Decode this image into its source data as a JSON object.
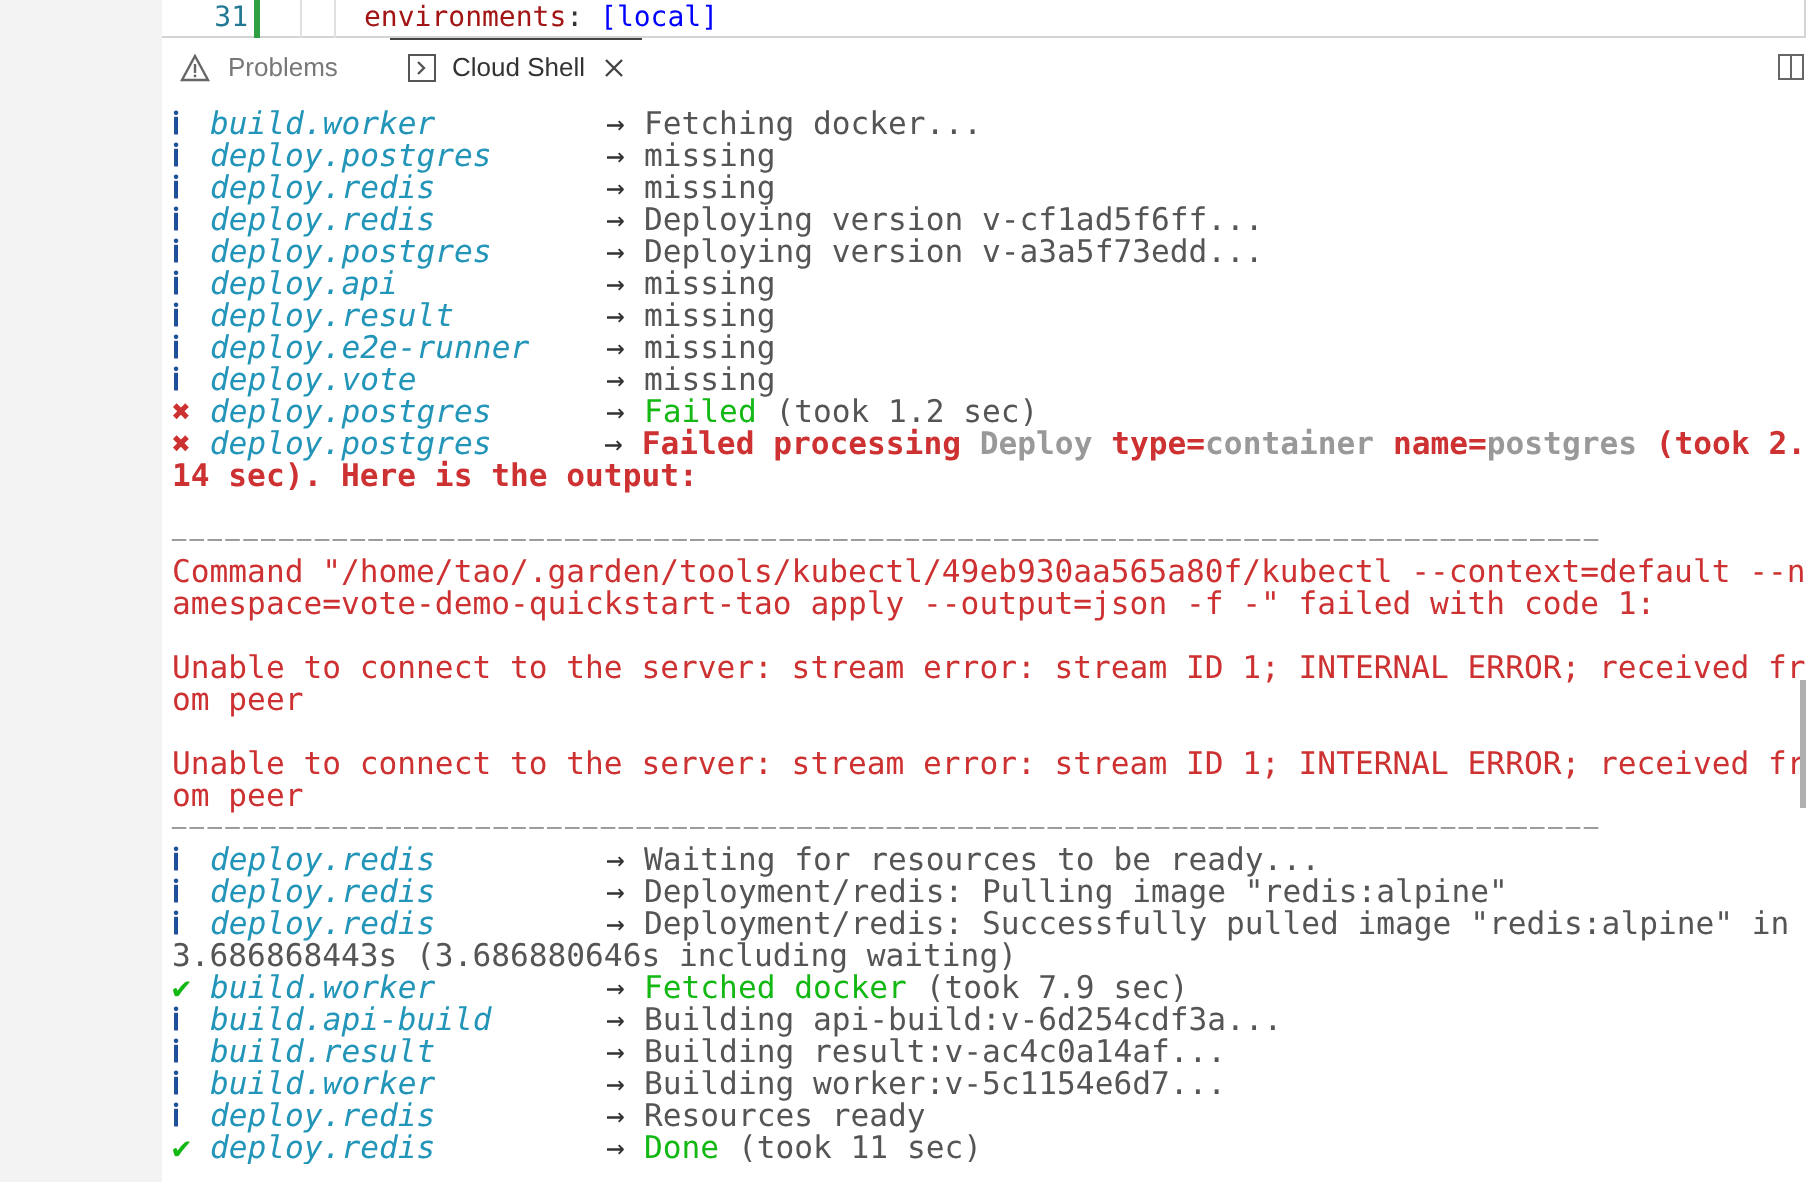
{
  "editor": {
    "line_number": "31",
    "code": [
      "environments",
      ": ",
      "[local]"
    ]
  },
  "panel_tabs": [
    {
      "label": "Problems",
      "selected": false
    },
    {
      "label": "Cloud Shell",
      "selected": true
    }
  ],
  "terminal_lines": [
    {
      "kind": "info",
      "mark": "ℹ",
      "name": "build.worker",
      "arrow": "→",
      "message": [
        {
          "text": "Fetching docker...",
          "kind": "dim"
        }
      ]
    },
    {
      "kind": "info",
      "mark": "ℹ",
      "name": "deploy.postgres",
      "arrow": "→",
      "message": [
        {
          "text": "missing",
          "kind": "dim"
        }
      ]
    },
    {
      "kind": "info",
      "mark": "ℹ",
      "name": "deploy.redis",
      "arrow": "→",
      "message": [
        {
          "text": "missing",
          "kind": "dim"
        }
      ]
    },
    {
      "kind": "info",
      "mark": "ℹ",
      "name": "deploy.redis",
      "arrow": "→",
      "message": [
        {
          "text": "Deploying version v-cf1ad5f6ff...",
          "kind": "dim"
        }
      ]
    },
    {
      "kind": "info",
      "mark": "ℹ",
      "name": "deploy.postgres",
      "arrow": "→",
      "message": [
        {
          "text": "Deploying version v-a3a5f73edd...",
          "kind": "dim"
        }
      ]
    },
    {
      "kind": "info",
      "mark": "ℹ",
      "name": "deploy.api",
      "arrow": "→",
      "message": [
        {
          "text": "missing",
          "kind": "dim"
        }
      ]
    },
    {
      "kind": "info",
      "mark": "ℹ",
      "name": "deploy.result",
      "arrow": "→",
      "message": [
        {
          "text": "missing",
          "kind": "dim"
        }
      ]
    },
    {
      "kind": "info",
      "mark": "ℹ",
      "name": "deploy.e2e-runner",
      "arrow": "→",
      "message": [
        {
          "text": "missing",
          "kind": "dim"
        }
      ]
    },
    {
      "kind": "info",
      "mark": "ℹ",
      "name": "deploy.vote",
      "arrow": "→",
      "message": [
        {
          "text": "missing",
          "kind": "dim"
        }
      ]
    },
    {
      "kind": "error",
      "mark": "✖",
      "name": "deploy.postgres",
      "arrow": "→",
      "message": [
        {
          "text": "Failed",
          "kind": "green"
        },
        {
          "text": " (took 1.2 sec)",
          "kind": "dim"
        }
      ]
    },
    {
      "kind": "error",
      "mark": "✖",
      "name": "deploy.postgres",
      "arrow": "→",
      "message": [
        {
          "text": "Failed processing ",
          "kind": "red_bold"
        },
        {
          "text": "Deploy ",
          "kind": "gray_bold"
        },
        {
          "text": "type=",
          "kind": "red_bold"
        },
        {
          "text": "container ",
          "kind": "gray_bold"
        },
        {
          "text": "name=",
          "kind": "red_bold"
        },
        {
          "text": "postgres ",
          "kind": "gray_bold"
        },
        {
          "text": "(took 2.",
          "kind": "red_bold"
        }
      ]
    },
    {
      "kind": "text",
      "segments": [
        {
          "text": "14 sec). Here is the output:",
          "kind": "red_bold"
        }
      ]
    },
    {
      "kind": "blank"
    },
    {
      "kind": "rule",
      "text": "────────────────────────────────────────────────────────────────────────────────"
    },
    {
      "kind": "text",
      "segments": [
        {
          "text": "Command \"/home/tao/.garden/tools/kubectl/49eb930aa565a80f/kubectl --context=default --n",
          "kind": "red"
        }
      ]
    },
    {
      "kind": "text",
      "segments": [
        {
          "text": "amespace=vote-demo-quickstart-tao apply --output=json -f -\" failed with code 1:",
          "kind": "red"
        }
      ]
    },
    {
      "kind": "blank"
    },
    {
      "kind": "text",
      "segments": [
        {
          "text": "Unable to connect to the server: stream error: stream ID 1; INTERNAL ERROR; received fr",
          "kind": "red"
        }
      ]
    },
    {
      "kind": "text",
      "segments": [
        {
          "text": "om peer",
          "kind": "red"
        }
      ]
    },
    {
      "kind": "blank"
    },
    {
      "kind": "text",
      "segments": [
        {
          "text": "Unable to connect to the server: stream error: stream ID 1; INTERNAL ERROR; received fr",
          "kind": "red"
        }
      ]
    },
    {
      "kind": "text",
      "segments": [
        {
          "text": "om peer",
          "kind": "red"
        }
      ]
    },
    {
      "kind": "rule",
      "text": "────────────────────────────────────────────────────────────────────────────────"
    },
    {
      "kind": "info",
      "mark": "ℹ",
      "name": "deploy.redis",
      "arrow": "→",
      "message": [
        {
          "text": "Waiting for resources to be ready...",
          "kind": "dim"
        }
      ]
    },
    {
      "kind": "info",
      "mark": "ℹ",
      "name": "deploy.redis",
      "arrow": "→",
      "message": [
        {
          "text": "Deployment/redis: Pulling image \"redis:alpine\"",
          "kind": "dim"
        }
      ]
    },
    {
      "kind": "info",
      "mark": "ℹ",
      "name": "deploy.redis",
      "arrow": "→",
      "message": [
        {
          "text": "Deployment/redis: Successfully pulled image \"redis:alpine\" in",
          "kind": "dim"
        }
      ]
    },
    {
      "kind": "text",
      "segments": [
        {
          "text": "3.686868443s (3.686880646s including waiting)",
          "kind": "dim"
        }
      ]
    },
    {
      "kind": "success",
      "mark": "✔",
      "name": "build.worker",
      "arrow": "→",
      "message": [
        {
          "text": "Fetched docker",
          "kind": "green"
        },
        {
          "text": " (took 7.9 sec)",
          "kind": "dim"
        }
      ]
    },
    {
      "kind": "info",
      "mark": "ℹ",
      "name": "build.api-build",
      "arrow": "→",
      "message": [
        {
          "text": "Building api-build:v-6d254cdf3a...",
          "kind": "dim"
        }
      ]
    },
    {
      "kind": "info",
      "mark": "ℹ",
      "name": "build.result",
      "arrow": "→",
      "message": [
        {
          "text": "Building result:v-ac4c0a14af...",
          "kind": "dim"
        }
      ]
    },
    {
      "kind": "info",
      "mark": "ℹ",
      "name": "build.worker",
      "arrow": "→",
      "message": [
        {
          "text": "Building worker:v-5c1154e6d7...",
          "kind": "dim"
        }
      ]
    },
    {
      "kind": "info",
      "mark": "ℹ",
      "name": "deploy.redis",
      "arrow": "→",
      "message": [
        {
          "text": "Resources ready",
          "kind": "dim"
        }
      ]
    },
    {
      "kind": "success",
      "mark": "✔",
      "name": "deploy.redis",
      "arrow": "→",
      "message": [
        {
          "text": "Done",
          "kind": "green"
        },
        {
          "text": " (took 11 sec)",
          "kind": "dim"
        }
      ]
    }
  ]
}
